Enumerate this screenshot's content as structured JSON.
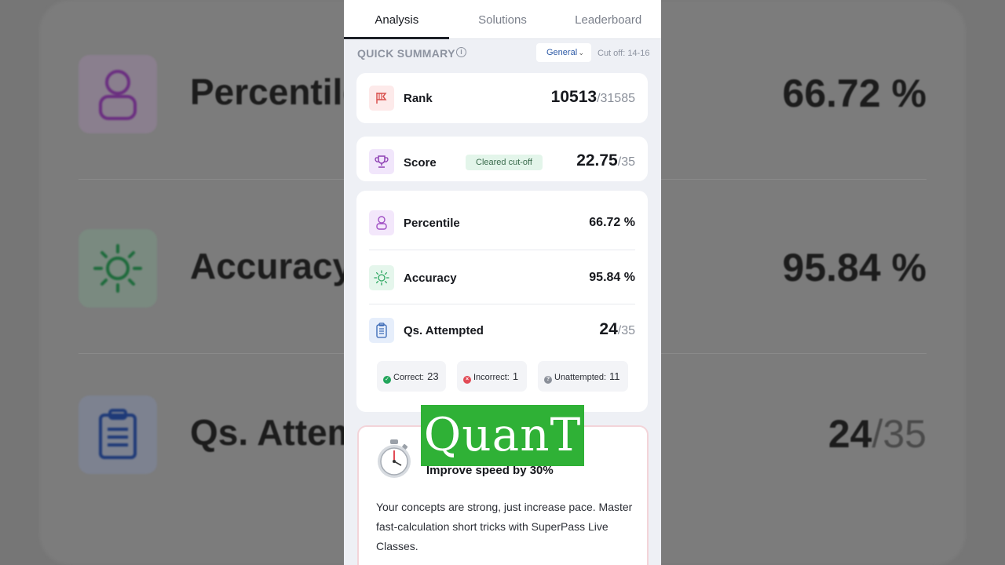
{
  "background": {
    "rows": [
      {
        "label": "Percentile",
        "value": "66.72 %"
      },
      {
        "label": "Accuracy",
        "value": "95.84 %"
      },
      {
        "label": "Qs. Attem",
        "value": "24",
        "denominator": "/35"
      }
    ]
  },
  "tabs": [
    {
      "label": "Analysis",
      "active": true
    },
    {
      "label": "Solutions",
      "active": false
    },
    {
      "label": "Leaderboard",
      "active": false
    }
  ],
  "summary": {
    "title": "QUICK SUMMARY",
    "info_icon": "i",
    "category": "General",
    "cutoff": "Cut off: 14-16"
  },
  "rank": {
    "label": "Rank",
    "value": "10513",
    "total": "/31585",
    "icon": "flag-icon"
  },
  "score": {
    "label": "Score",
    "badge": "Cleared cut-off",
    "value": "22.75",
    "total": "/35",
    "icon": "trophy-icon"
  },
  "stats": {
    "percentile": {
      "label": "Percentile",
      "value": "66.72 %",
      "icon": "person-icon"
    },
    "accuracy": {
      "label": "Accuracy",
      "value": "95.84 %",
      "icon": "sun-icon"
    },
    "attempted": {
      "label": "Qs. Attempted",
      "value": "24",
      "total": "/35",
      "icon": "clipboard-icon"
    }
  },
  "breakdown": {
    "correct": {
      "label": "Correct:",
      "value": "23",
      "color": "#22a55b"
    },
    "incorrect": {
      "label": "Incorrect:",
      "value": "1",
      "color": "#e24a55"
    },
    "unattempted": {
      "label": "Unattempted:",
      "value": "11",
      "color": "#8a8f99"
    }
  },
  "tip": {
    "title": "Improve speed by 30%",
    "body": "Your concepts are strong, just increase pace. Master fast-calculation short tricks with SuperPass Live Classes."
  },
  "watermark": "QuanT",
  "colors": {
    "rank_icon_bg": "#fdeaea",
    "score_icon_bg": "#f1e6fb",
    "percentile_icon_bg": "#f3e7fb",
    "accuracy_icon_bg": "#e5f6ec",
    "attempted_icon_bg": "#e6eefb",
    "watermark_bg": "#2fb136"
  }
}
